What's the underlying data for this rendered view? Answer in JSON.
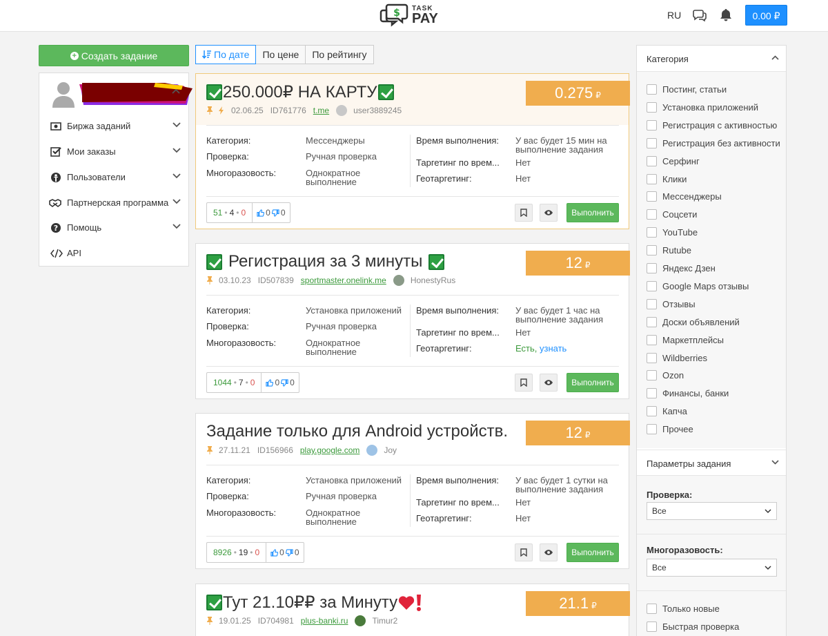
{
  "header": {
    "logo_top": "TASK",
    "logo_bottom": "PAY",
    "lang": "RU",
    "balance": "0.00 ₽"
  },
  "sidebar": {
    "create_label": "Создать задание",
    "items": [
      {
        "label": "Биржа заданий",
        "icon": "money-icon"
      },
      {
        "label": "Мои заказы",
        "icon": "checkbox-icon"
      },
      {
        "label": "Пользователи",
        "icon": "user-circle-icon"
      },
      {
        "label": "Партнерская программа",
        "icon": "handshake-icon"
      },
      {
        "label": "Помощь",
        "icon": "question-icon"
      },
      {
        "label": "API",
        "icon": "code-icon"
      }
    ]
  },
  "sort": {
    "tabs": [
      "По дате",
      "По цене",
      "По рейтингу"
    ],
    "active": 0
  },
  "labels": {
    "category": "Категория:",
    "check": "Проверка:",
    "repeat": "Многоразовость:",
    "time": "Время выполнения:",
    "targeting_time": "Таргетинг по врем...",
    "geo": "Геотаргетинг:",
    "do": "Выполнить"
  },
  "tasks": [
    {
      "title_pre": "",
      "title": "250.000₽ НА КАРТУ",
      "price": "0.275",
      "currency": "₽",
      "date": "02.06.25",
      "id": "ID761776",
      "site": "t.me",
      "user": "user3889245",
      "category": "Мессенджеры",
      "check": "Ручная проверка",
      "repeat": "Однократное выполнение",
      "time": "У вас будет 15 мин на выполнение задания",
      "targeting_time": "Нет",
      "geo": "Нет",
      "geo_link": "",
      "stat_done": "51",
      "stat_mid": "4",
      "stat_bad": "0",
      "likes": "0",
      "dislikes": "0"
    },
    {
      "title": "Регистрация за 3 минуты",
      "price": "12",
      "currency": "₽",
      "date": "03.10.23",
      "id": "ID507839",
      "site": "sportmaster.onelink.me",
      "user": "HonestyRus",
      "category": "Установка приложений",
      "check": "Ручная проверка",
      "repeat": "Однократное выполнение",
      "time": "У вас будет 1 час на выполнение задания",
      "targeting_time": "Нет",
      "geo": "Есть,",
      "geo_link": "узнать",
      "stat_done": "1044",
      "stat_mid": "7",
      "stat_bad": "0",
      "likes": "0",
      "dislikes": "0"
    },
    {
      "title": "Задание только для Android устройств.",
      "price": "12",
      "currency": "₽",
      "date": "27.11.21",
      "id": "ID156966",
      "site": "play.google.com",
      "user": "Joy",
      "category": "Установка приложений",
      "check": "Ручная проверка",
      "repeat": "Однократное выполнение",
      "time": "У вас будет 1 сутки на выполнение задания",
      "targeting_time": "Нет",
      "geo": "Нет",
      "geo_link": "",
      "stat_done": "8926",
      "stat_mid": "19",
      "stat_bad": "0",
      "likes": "0",
      "dislikes": "0"
    },
    {
      "title": "Тут 21.10₽₽ за Минуту",
      "price": "21.1",
      "currency": "₽",
      "date": "19.01.25",
      "id": "ID704981",
      "site": "plus-banki.ru",
      "user": "Timur2"
    }
  ],
  "filter": {
    "category_title": "Категория",
    "categories": [
      "Постинг, статьи",
      "Установка приложений",
      "Регистрация с активностью",
      "Регистрация без активности",
      "Серфинг",
      "Клики",
      "Мессенджеры",
      "Соцсети",
      "YouTube",
      "Rutube",
      "Яндекс Дзен",
      "Google Maps отзывы",
      "Отзывы",
      "Доски объявлений",
      "Маркетплейсы",
      "Wildberries",
      "Ozon",
      "Финансы, банки",
      "Капча",
      "Прочее"
    ],
    "params_title": "Параметры задания",
    "check_label": "Проверка:",
    "check_value": "Все",
    "repeat_label": "Многоразовость:",
    "repeat_value": "Все",
    "extra": [
      "Только новые",
      "Быстрая проверка"
    ]
  }
}
